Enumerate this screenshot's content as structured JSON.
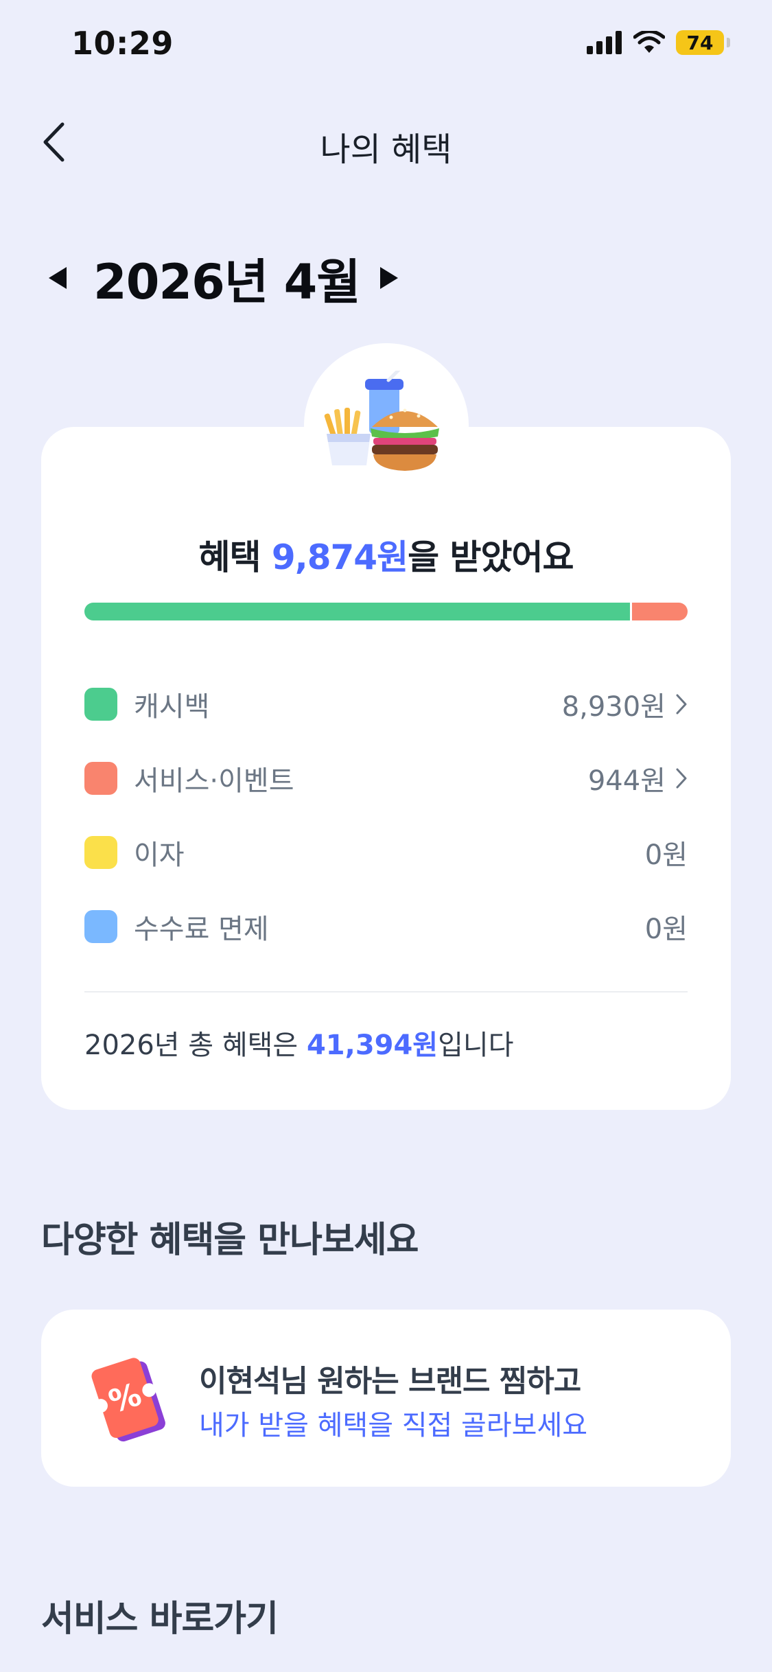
{
  "status_bar": {
    "time": "10:29",
    "battery": "74"
  },
  "nav": {
    "title": "나의 혜택"
  },
  "month": {
    "label": "2026년 4월"
  },
  "summary": {
    "prefix": "혜택 ",
    "amount": "9,874원",
    "suffix": "을 받았어요",
    "progress": [
      {
        "name": "캐시백",
        "fraction": 0.904,
        "color": "#4ccc8e"
      },
      {
        "name": "서비스·이벤트",
        "fraction": 0.096,
        "color": "#f9846e"
      }
    ],
    "items": [
      {
        "label": "캐시백",
        "value": "8,930원",
        "color": "#4ccc8e",
        "has_arrow": true
      },
      {
        "label": "서비스·이벤트",
        "value": "944원",
        "color": "#f9846e",
        "has_arrow": true
      },
      {
        "label": "이자",
        "value": "0원",
        "color": "#fbe04a",
        "has_arrow": false
      },
      {
        "label": "수수료 면제",
        "value": "0원",
        "color": "#7ab8ff",
        "has_arrow": false
      }
    ],
    "total_prefix": "2026년 총 혜택은 ",
    "total_amount": "41,394원",
    "total_suffix": "입니다"
  },
  "benefits_section": {
    "title": "다양한 혜택을 만나보세요"
  },
  "promo": {
    "line1": "이현석님 원하는 브랜드 찜하고",
    "line2": "내가 받을 혜택을 직접 골라보세요",
    "icon": "coupon-icon"
  },
  "shortcuts_section": {
    "title": "서비스 바로가기"
  },
  "colors": {
    "accent": "#4c6bff",
    "background": "#eceefb"
  }
}
